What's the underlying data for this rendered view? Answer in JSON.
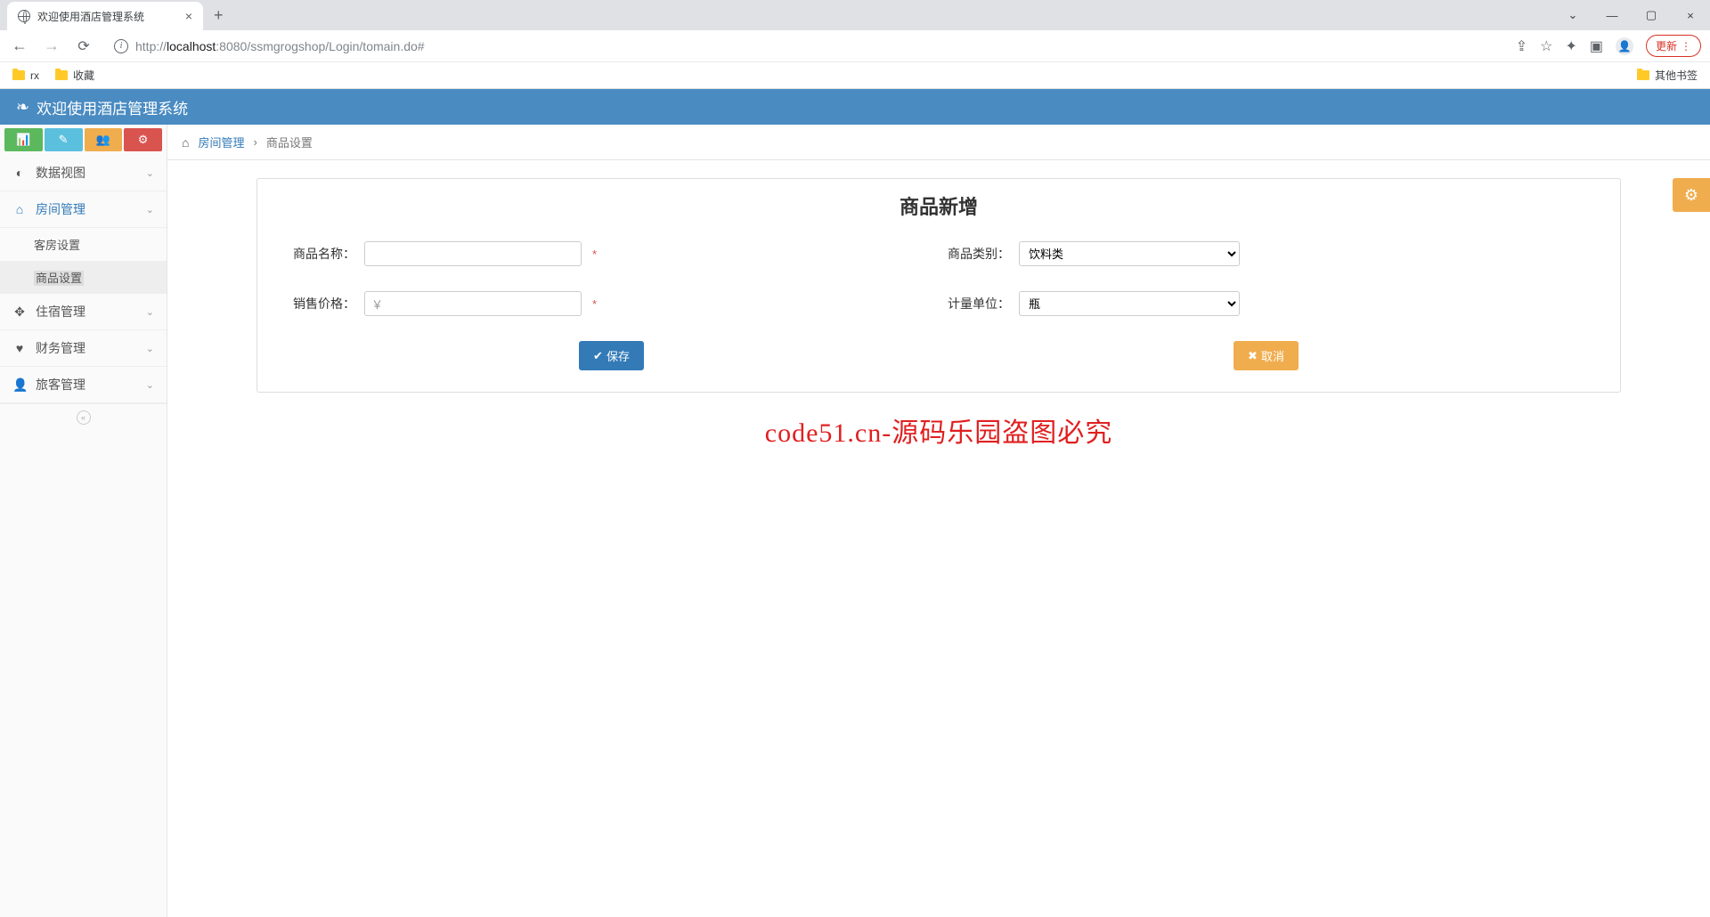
{
  "browser": {
    "tab_title": "欢迎使用酒店管理系统",
    "url_prefix": "http://",
    "url_host": "localhost",
    "url_port": ":8080",
    "url_path": "/ssmgrogshop/Login/tomain.do#",
    "update_label": "更新",
    "bookmarks": {
      "rx": "rx",
      "fav": "收藏",
      "other": "其他书签"
    }
  },
  "app": {
    "title": "欢迎使用酒店管理系统"
  },
  "sidebar": {
    "items": [
      {
        "icon": "dashboard",
        "label": "数据视图"
      },
      {
        "icon": "home",
        "label": "房间管理"
      },
      {
        "icon": "move",
        "label": "住宿管理"
      },
      {
        "icon": "heart",
        "label": "财务管理"
      },
      {
        "icon": "user",
        "label": "旅客管理"
      }
    ],
    "sub_room": [
      {
        "label": "客房设置"
      },
      {
        "label": "商品设置"
      }
    ]
  },
  "breadcrumb": {
    "parent": "房间管理",
    "current": "商品设置",
    "sep": "›"
  },
  "form": {
    "title": "商品新增",
    "name_label": "商品名称：",
    "category_label": "商品类别：",
    "category_value": "饮料类",
    "price_label": "销售价格：",
    "price_prefix": "￥",
    "unit_label": "计量单位：",
    "unit_value": "瓶",
    "save_label": "保存",
    "cancel_label": "取消"
  },
  "watermark": "code51.cn-源码乐园盗图必究"
}
